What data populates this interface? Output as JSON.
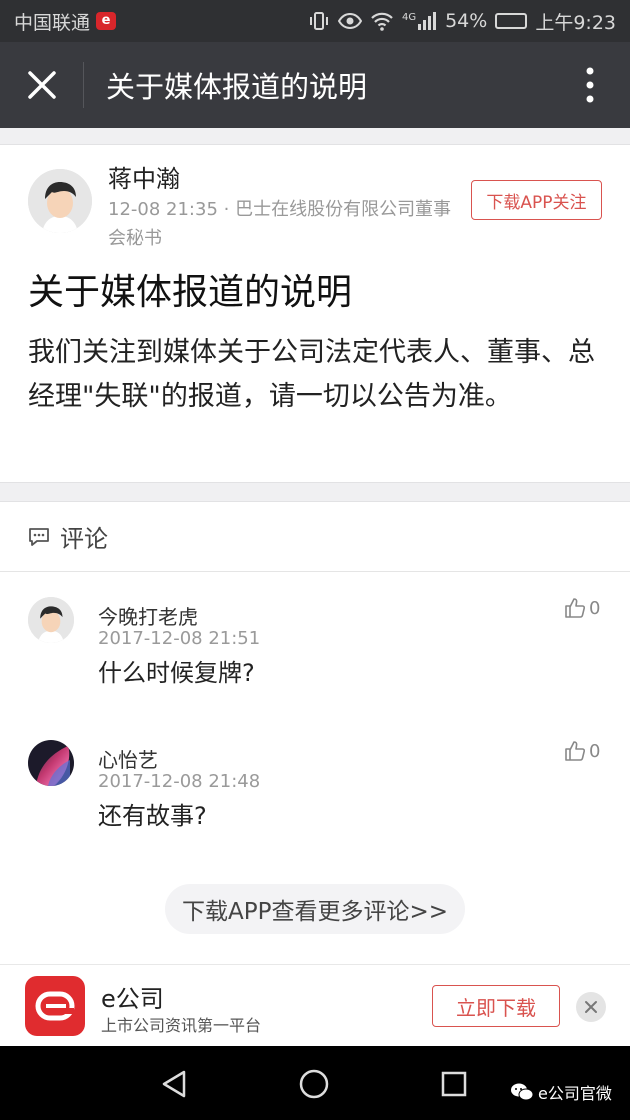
{
  "status_bar": {
    "carrier": "中国联通",
    "carrier_badge": "e",
    "network_type": "4G",
    "battery": "54%",
    "battery_level": 0.54,
    "time": "上午9:23"
  },
  "nav": {
    "title": "关于媒体报道的说明"
  },
  "article": {
    "author_name": "蒋中瀚",
    "author_meta": "12-08 21:35 · 巴士在线股份有限公司董事会秘书",
    "follow_label": "下载APP关注",
    "title": "关于媒体报道的说明",
    "body": "我们关注到媒体关于公司法定代表人、董事、总经理\"失联\"的报道，请一切以公告为准。"
  },
  "comments": {
    "header_label": "评论",
    "items": [
      {
        "name": "今晚打老虎",
        "time": "2017-12-08 21:51",
        "text": "什么时候复牌?",
        "likes": "0"
      },
      {
        "name": "心怡艺",
        "time": "2017-12-08 21:48",
        "text": "还有故事?",
        "likes": "0"
      }
    ],
    "more_label": "下载APP查看更多评论>>"
  },
  "app_banner": {
    "name": "e公司",
    "slogan": "上市公司资讯第一平台",
    "download_label": "立即下载"
  },
  "watermark": "e公司官微",
  "colors": {
    "accent_red": "#d9534f",
    "nav_bg": "#393a3f",
    "status_bg": "#2f3033"
  }
}
